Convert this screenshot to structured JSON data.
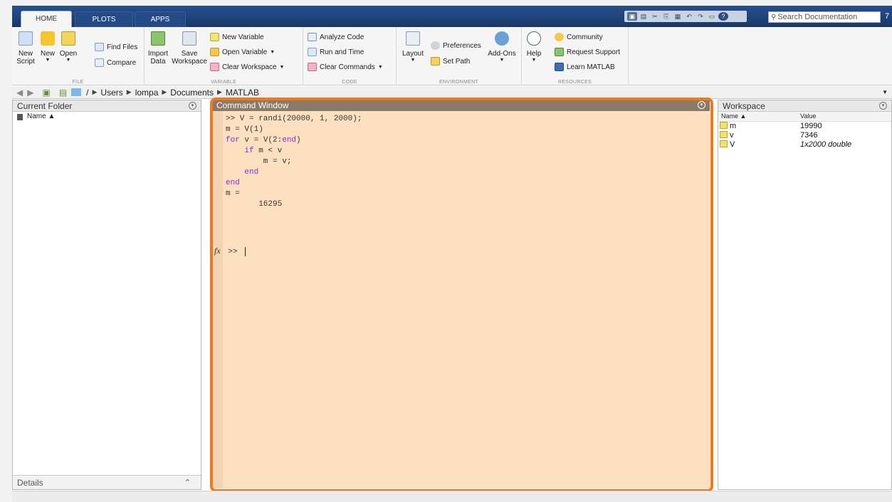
{
  "tabs": [
    "HOME",
    "PLOTS",
    "APPS"
  ],
  "search": {
    "placeholder": "Search Documentation",
    "after": "7"
  },
  "ribbon": {
    "file": {
      "group": "FILE",
      "new_script": "New\nScript",
      "new": "New",
      "open": "Open",
      "find_files": "Find Files",
      "compare": "Compare"
    },
    "variable": {
      "group": "VARIABLE",
      "import_data": "Import\nData",
      "save_workspace": "Save\nWorkspace",
      "new_variable": "New Variable",
      "open_variable": "Open Variable",
      "clear_workspace": "Clear Workspace"
    },
    "code": {
      "group": "CODE",
      "analyze_code": "Analyze Code",
      "run_and_time": "Run and Time",
      "clear_commands": "Clear Commands"
    },
    "environment": {
      "group": "ENVIRONMENT",
      "layout": "Layout",
      "preferences": "Preferences",
      "set_path": "Set Path",
      "addons": "Add-Ons"
    },
    "resources": {
      "group": "RESOURCES",
      "help": "Help",
      "community": "Community",
      "request_support": "Request Support",
      "learn_matlab": "Learn MATLAB"
    }
  },
  "address": {
    "path": [
      "/",
      "Users",
      "lompa",
      "Documents",
      "MATLAB"
    ]
  },
  "current_folder": {
    "title": "Current Folder",
    "col_name": "Name ▲",
    "details": "Details"
  },
  "command_window": {
    "title": "Command Window",
    "lines": [
      ">> V = randi(20000, 1, 2000);",
      "m = V(1)",
      "for v = V(2:end)",
      "    if m < v",
      "        m = v;",
      "    end",
      "end",
      "",
      "m =",
      "",
      "       16295"
    ],
    "prompt_fx": "fx",
    "prompt": ">>"
  },
  "workspace": {
    "title": "Workspace",
    "headers": [
      "Name ▲",
      "Value"
    ],
    "rows": [
      {
        "name": "m",
        "value": "19990"
      },
      {
        "name": "v",
        "value": "7346"
      },
      {
        "name": "V",
        "value": "1x2000 double"
      }
    ]
  }
}
